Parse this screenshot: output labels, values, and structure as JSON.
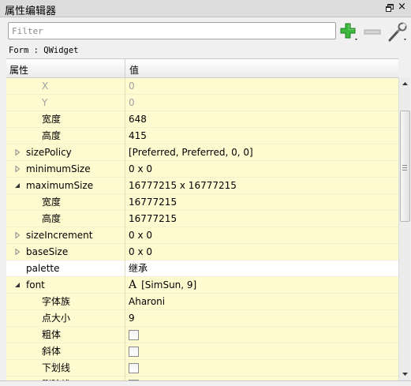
{
  "window": {
    "title": "属性编辑器",
    "float_icon": "float-window-icon",
    "close_icon": "close-icon",
    "close_glyph": "×"
  },
  "toolbar": {
    "filter_placeholder": "Filter",
    "filter_value": "",
    "add_icon": "green-plus-icon",
    "remove_icon": "minus-icon",
    "configure_icon": "wrench-icon"
  },
  "class_label": "Form : QWidget",
  "header": {
    "property": "属性",
    "value": "值"
  },
  "rows": [
    {
      "name": "X",
      "value": "0",
      "level": 1,
      "disabled": true,
      "bg": "y"
    },
    {
      "name": "Y",
      "value": "0",
      "level": 1,
      "disabled": true,
      "bg": "y"
    },
    {
      "name": "宽度",
      "value": "648",
      "level": 1,
      "bg": "y"
    },
    {
      "name": "高度",
      "value": "415",
      "level": 1,
      "bg": "y"
    },
    {
      "name": "sizePolicy",
      "value": "[Preferred, Preferred, 0, 0]",
      "level": 0,
      "expander": "collapsed",
      "bg": "y"
    },
    {
      "name": "minimumSize",
      "value": "0 x 0",
      "level": 0,
      "expander": "collapsed",
      "bg": "y"
    },
    {
      "name": "maximumSize",
      "value": "16777215 x 16777215",
      "level": 0,
      "expander": "expanded",
      "bg": "y"
    },
    {
      "name": "宽度",
      "value": "16777215",
      "level": 1,
      "bg": "y"
    },
    {
      "name": "高度",
      "value": "16777215",
      "level": 1,
      "bg": "y"
    },
    {
      "name": "sizeIncrement",
      "value": "0 x 0",
      "level": 0,
      "expander": "collapsed",
      "bg": "y"
    },
    {
      "name": "baseSize",
      "value": "0 x 0",
      "level": 0,
      "expander": "collapsed",
      "bg": "y"
    },
    {
      "name": "palette",
      "value": "继承",
      "level": 0,
      "bg": "w"
    },
    {
      "name": "font",
      "value": "[SimSun, 9]",
      "level": 0,
      "expander": "expanded",
      "font_icon": "font-A-icon",
      "font_glyph": "A",
      "bg": "y"
    },
    {
      "name": "字体族",
      "value": "Aharoni",
      "level": 1,
      "bg": "y"
    },
    {
      "name": "点大小",
      "value": "9",
      "level": 1,
      "bg": "y"
    },
    {
      "name": "粗体",
      "value": "",
      "level": 1,
      "checkbox": true,
      "checked": false,
      "bg": "y"
    },
    {
      "name": "斜体",
      "value": "",
      "level": 1,
      "checkbox": true,
      "checked": false,
      "bg": "y"
    },
    {
      "name": "下划线",
      "value": "",
      "level": 1,
      "checkbox": true,
      "checked": false,
      "bg": "y"
    },
    {
      "name": "删除线",
      "value": "",
      "level": 1,
      "checkbox": true,
      "checked": false,
      "bg": "y"
    }
  ],
  "scrollbar": {
    "position_fraction": 0.3
  }
}
